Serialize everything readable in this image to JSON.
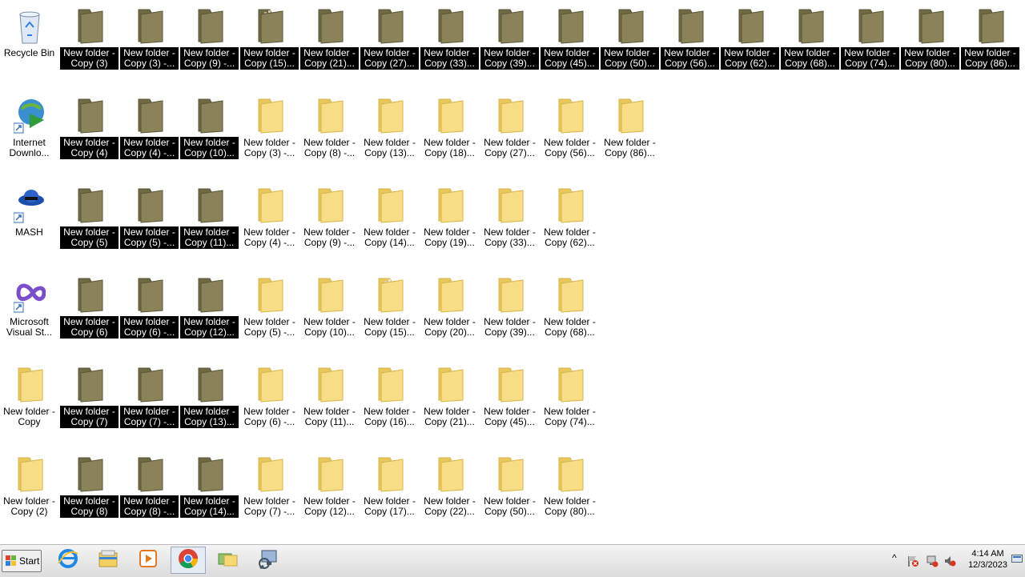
{
  "desktop": {
    "columns": [
      [
        {
          "label": "Recycle Bin",
          "type": "recycle",
          "selected": false
        },
        {
          "label": "Internet\nDownlo...",
          "type": "idm",
          "selected": false
        },
        {
          "label": "MASH",
          "type": "mash",
          "selected": false
        },
        {
          "label": "Microsoft\nVisual St...",
          "type": "vs",
          "selected": false
        },
        {
          "label": "New folder -\nCopy",
          "type": "folder",
          "selected": false
        },
        {
          "label": "New folder -\nCopy (2)",
          "type": "folder",
          "selected": false
        }
      ],
      [
        {
          "label": "New folder -\nCopy (3)",
          "type": "folder",
          "selected": true
        },
        {
          "label": "New folder -\nCopy (4)",
          "type": "folder",
          "selected": true
        },
        {
          "label": "New folder -\nCopy (5)",
          "type": "folder",
          "selected": true
        },
        {
          "label": "New folder -\nCopy (6)",
          "type": "folder",
          "selected": true
        },
        {
          "label": "New folder -\nCopy (7)",
          "type": "folder",
          "selected": true
        },
        {
          "label": "New folder -\nCopy (8)",
          "type": "folder",
          "selected": true
        }
      ],
      [
        {
          "label": "New folder -\nCopy (3) -...",
          "type": "folder",
          "selected": true
        },
        {
          "label": "New folder -\nCopy (4) -...",
          "type": "folder",
          "selected": true
        },
        {
          "label": "New folder -\nCopy (5) -...",
          "type": "folder",
          "selected": true
        },
        {
          "label": "New folder -\nCopy (6) -...",
          "type": "folder",
          "selected": true
        },
        {
          "label": "New folder -\nCopy (7) -...",
          "type": "folder",
          "selected": true
        },
        {
          "label": "New folder -\nCopy (8) -...",
          "type": "folder",
          "selected": true
        }
      ],
      [
        {
          "label": "New folder -\nCopy (9) -...",
          "type": "folder",
          "selected": true
        },
        {
          "label": "New folder -\nCopy (10)...",
          "type": "folder",
          "selected": true
        },
        {
          "label": "New folder -\nCopy (11)...",
          "type": "folder",
          "selected": true
        },
        {
          "label": "New folder -\nCopy (12)...",
          "type": "folder",
          "selected": true
        },
        {
          "label": "New folder -\nCopy (13)...",
          "type": "folder",
          "selected": true
        },
        {
          "label": "New folder -\nCopy (14)...",
          "type": "folder",
          "selected": true
        }
      ],
      [
        {
          "label": "New folder -\nCopy (15)...",
          "type": "folder-files",
          "selected": true
        },
        {
          "label": "New folder -\nCopy (3) -...",
          "type": "folder",
          "selected": false
        },
        {
          "label": "New folder -\nCopy (4) -...",
          "type": "folder",
          "selected": false
        },
        {
          "label": "New folder -\nCopy (5) -...",
          "type": "folder",
          "selected": false
        },
        {
          "label": "New folder -\nCopy (6) -...",
          "type": "folder",
          "selected": false
        },
        {
          "label": "New folder -\nCopy (7) -...",
          "type": "folder",
          "selected": false
        }
      ],
      [
        {
          "label": "New folder -\nCopy (21)...",
          "type": "folder",
          "selected": true
        },
        {
          "label": "New folder -\nCopy (8) -...",
          "type": "folder",
          "selected": false
        },
        {
          "label": "New folder -\nCopy (9) -...",
          "type": "folder",
          "selected": false
        },
        {
          "label": "New folder -\nCopy (10)...",
          "type": "folder",
          "selected": false
        },
        {
          "label": "New folder -\nCopy (11)...",
          "type": "folder",
          "selected": false
        },
        {
          "label": "New folder -\nCopy (12)...",
          "type": "folder",
          "selected": false
        }
      ],
      [
        {
          "label": "New folder -\nCopy (27)...",
          "type": "folder",
          "selected": true
        },
        {
          "label": "New folder -\nCopy (13)...",
          "type": "folder",
          "selected": false
        },
        {
          "label": "New folder -\nCopy (14)...",
          "type": "folder",
          "selected": false
        },
        {
          "label": "New folder -\nCopy (15)...",
          "type": "folder-files",
          "selected": false
        },
        {
          "label": "New folder -\nCopy (16)...",
          "type": "folder",
          "selected": false
        },
        {
          "label": "New folder -\nCopy (17)...",
          "type": "folder",
          "selected": false
        }
      ],
      [
        {
          "label": "New folder -\nCopy (33)...",
          "type": "folder",
          "selected": true
        },
        {
          "label": "New folder -\nCopy (18)...",
          "type": "folder",
          "selected": false
        },
        {
          "label": "New folder -\nCopy (19)...",
          "type": "folder",
          "selected": false
        },
        {
          "label": "New folder -\nCopy (20)...",
          "type": "folder",
          "selected": false
        },
        {
          "label": "New folder -\nCopy (21)...",
          "type": "folder",
          "selected": false
        },
        {
          "label": "New folder -\nCopy (22)...",
          "type": "folder",
          "selected": false
        }
      ],
      [
        {
          "label": "New folder -\nCopy (39)...",
          "type": "folder",
          "selected": true
        },
        {
          "label": "New folder -\nCopy (27)...",
          "type": "folder",
          "selected": false
        },
        {
          "label": "New folder -\nCopy (33)...",
          "type": "folder",
          "selected": false
        },
        {
          "label": "New folder -\nCopy (39)...",
          "type": "folder",
          "selected": false
        },
        {
          "label": "New folder -\nCopy (45)...",
          "type": "folder",
          "selected": false
        },
        {
          "label": "New folder -\nCopy (50)...",
          "type": "folder",
          "selected": false
        }
      ],
      [
        {
          "label": "New folder -\nCopy (45)...",
          "type": "folder",
          "selected": true
        },
        {
          "label": "New folder -\nCopy (56)...",
          "type": "folder",
          "selected": false
        },
        {
          "label": "New folder -\nCopy (62)...",
          "type": "folder",
          "selected": false
        },
        {
          "label": "New folder -\nCopy (68)...",
          "type": "folder",
          "selected": false
        },
        {
          "label": "New folder -\nCopy (74)...",
          "type": "folder",
          "selected": false
        },
        {
          "label": "New folder -\nCopy (80)...",
          "type": "folder",
          "selected": false
        }
      ],
      [
        {
          "label": "New folder -\nCopy (50)...",
          "type": "folder",
          "selected": true
        },
        {
          "label": "New folder -\nCopy (86)...",
          "type": "folder",
          "selected": false
        }
      ],
      [
        {
          "label": "New folder -\nCopy (56)...",
          "type": "folder",
          "selected": true
        }
      ],
      [
        {
          "label": "New folder -\nCopy (62)...",
          "type": "folder",
          "selected": true
        }
      ],
      [
        {
          "label": "New folder -\nCopy (68)...",
          "type": "folder",
          "selected": true
        }
      ],
      [
        {
          "label": "New folder -\nCopy (74)...",
          "type": "folder",
          "selected": true
        }
      ],
      [
        {
          "label": "New folder -\nCopy (80)...",
          "type": "folder",
          "selected": true
        }
      ],
      [
        {
          "label": "New folder -\nCopy (86)...",
          "type": "folder",
          "selected": true
        }
      ]
    ]
  },
  "taskbar": {
    "start_label": "Start",
    "pinned": [
      {
        "name": "internet-explorer-icon",
        "active": false
      },
      {
        "name": "file-explorer-icon",
        "active": false
      },
      {
        "name": "media-player-icon",
        "active": false
      },
      {
        "name": "chrome-icon",
        "active": true
      },
      {
        "name": "folders-icon",
        "active": false
      },
      {
        "name": "network-computer-icon",
        "active": false
      }
    ],
    "tray": {
      "chevron": "^",
      "time": "4:14 AM",
      "date": "12/3/2023"
    }
  },
  "colors": {
    "folder_yellow": "#f5d977",
    "folder_selected": "#8a8258",
    "selection_bg": "#000000"
  }
}
